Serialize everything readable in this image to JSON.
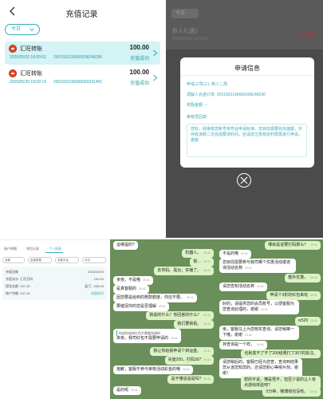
{
  "recharge": {
    "title": "充值记录",
    "filter": "今日",
    "records": [
      {
        "name": "汇旺转账",
        "amount": "100.00",
        "time": "2025/05/20 18:09:52",
        "order_no": "2001602196600008248290",
        "status": "充值成功"
      },
      {
        "name": "汇旺转账",
        "amount": "100.00",
        "time": "2025/05/20 18:09:19",
        "order_no": "2001602196600000231491",
        "status": "充值成功"
      }
    ]
  },
  "modal_bg": {
    "pill": "今日",
    "title": "新人礼遇2",
    "subtitle": "2025/05/20 18:09:51",
    "status": "已拒绝"
  },
  "dialog": {
    "title": "申请信息",
    "line1": "申请三项(三): 新人二周",
    "line2": "调解人充值订单: 2001602196600008248290",
    "line3": "奖励金额: --",
    "line4": "审核员回复:",
    "reply": "您好，经审核您账号未符合申请标准，您目前需要完充值额，并存有流转二次完成要求时间，还请您注意规定时限再进行申请，谢谢"
  },
  "list": {
    "tabs": [
      "账户明细",
      "钱包记录",
      "个人报表"
    ],
    "chips": [
      "全部",
      "全部类型",
      "全部平台",
      "今日"
    ],
    "card": {
      "row1_l": "充值金额",
      "row1_r": "2025/05/20",
      "row2_l": "充值流水: 汇旺扫码",
      "row2_r": "100.00",
      "row3_l": "提现金额: 337.43",
      "row3_r": "盈亏: -258.53",
      "row4_l": "账户余额: 337.43",
      "row4_r": "充值成功"
    }
  },
  "chat1": {
    "messages": [
      {
        "dir": "in",
        "text": "运维提的?"
      },
      {
        "dir": "out",
        "text": "机器人。",
        "time": "20:41"
      },
      {
        "dir": "out",
        "text": "我…",
        "time": "20:41"
      },
      {
        "dir": "out",
        "text": "去你妈。黑台，实锤了。",
        "time": "20:41"
      },
      {
        "dir": "in",
        "text": "亲亲，不是哦",
        "time": "20:41"
      },
      {
        "dir": "in",
        "text": "是真客服的",
        "time": "20:41"
      },
      {
        "dir": "in",
        "text": "因您要是给到的赠款额度，你还不要。",
        "time": "20:41"
      },
      {
        "dir": "in",
        "text": "要催促你的您是否理解",
        "time": "20:41"
      },
      {
        "dir": "out",
        "text": "我说的什么？你回答的什么？",
        "time": "20:41"
      },
      {
        "dir": "out",
        "text": "我们要我看。",
        "time": "20:41"
      },
      {
        "dir": "out",
        "text": "你说你给的红包不需要申请的",
        "time": "20:41"
      },
      {
        "dir": "in",
        "text": "亲亲，我司红包不需要申请的",
        "time": "20:41"
      },
      {
        "dir": "out",
        "text": "我让你给我申请个转运金。",
        "time": "20:41"
      },
      {
        "dir": "out",
        "text": "充值200，打码307",
        "time": "20:41"
      },
      {
        "dir": "in",
        "text": "抱歉，客服不参与审核活动彩金的哦",
        "time": "20:41"
      },
      {
        "dir": "out",
        "text": "是不懂说话是吗?",
        "time": "20:41"
      },
      {
        "dir": "in",
        "text": "是的呢",
        "time": "20:41"
      }
    ]
  },
  "chat2": {
    "messages": [
      {
        "dir": "out",
        "text": "哪就是说要打码那么？",
        "time": "20:41"
      },
      {
        "dir": "in",
        "text": "不是的哦",
        "time": "20:41"
      },
      {
        "dir": "in",
        "text": "您目前需要参与我司哪个优惠活动或咨询活动名称",
        "time": "20:41"
      },
      {
        "dir": "out",
        "text": "额外优惠。",
        "time": "20:41"
      },
      {
        "dir": "in",
        "text": "请您告知活动名称",
        "time": "20:41"
      },
      {
        "dir": "out",
        "text": "申请个3折的红包来玩",
        "time": "20:41"
      },
      {
        "dir": "in",
        "text": "好的，请提供您的会员账号，以便客服为您查询处理的，谢谢",
        "time": "20:41"
      },
      {
        "dir": "out",
        "text": "rz520",
        "time": "20:41"
      },
      {
        "dir": "in",
        "text": "亲，客服马上为您核实查询，请您稍等一下哦，谢谢",
        "time": "20:41"
      },
      {
        "dir": "in",
        "text": "存查询是一个样，",
        "time": "20:41"
      },
      {
        "dir": "out",
        "text": "也就变不了不了200结果打了307的投注。",
        "time": "20:41"
      },
      {
        "dir": "in",
        "text": "请您稍后的，客服已经为您查，查询到结果您从该您知您的，还请您耐心等候片刻，谢谢！",
        "time": "20:41"
      },
      {
        "dir": "out",
        "text": "想的不说，懂是怪不，但至少说的让人有点游戏体验吧?",
        "time": "20:41"
      },
      {
        "dir": "out",
        "text": "5分钟，赌博钱也没有。",
        "time": "20:41"
      },
      {
        "dir": "out",
        "text": "5分钟还在说二次充值的时间。",
        "time": "20:41"
      }
    ]
  }
}
